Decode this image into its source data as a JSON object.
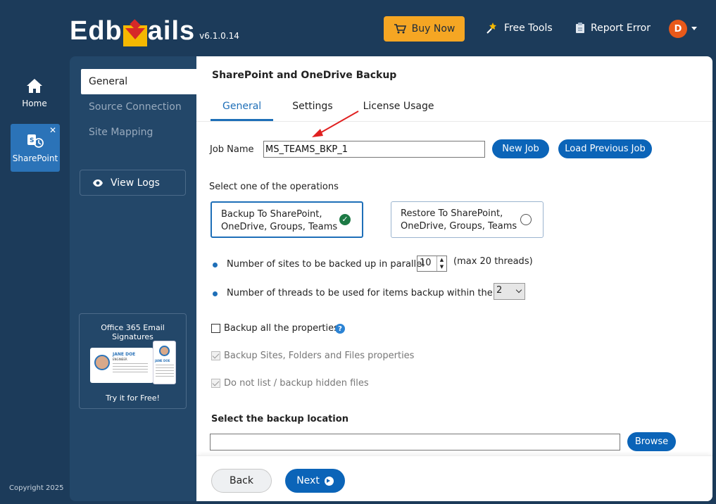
{
  "header": {
    "logo_left": "Edb",
    "logo_right": "ails",
    "version": "v6.1.0.14",
    "buy_now": "Buy Now",
    "free_tools": "Free Tools",
    "report_error": "Report Error",
    "avatar_initial": "D"
  },
  "rail": {
    "home_label": "Home",
    "sharepoint_label": "SharePoint",
    "close_glyph": "✕",
    "copyright": "Copyright 2025"
  },
  "sidenav": {
    "items": [
      {
        "label": "General"
      },
      {
        "label": "Source Connection"
      },
      {
        "label": "Site Mapping"
      }
    ],
    "view_logs": "View Logs",
    "promo_title": "Office 365 Email Signatures",
    "promo_name": "JANE DOE",
    "promo_role": "ENGINEER",
    "promo_cta": "Try it for Free!"
  },
  "main": {
    "title": "SharePoint and OneDrive Backup",
    "tabs": [
      {
        "label": "General"
      },
      {
        "label": "Settings"
      },
      {
        "label": "License Usage"
      }
    ],
    "job_name_label": "Job Name",
    "job_name_value": "MS_TEAMS_BKP_1",
    "new_job": "New Job",
    "load_previous_job": "Load Previous Job",
    "operations_label": "Select one of the operations",
    "op_backup_line1": "Backup To SharePoint,",
    "op_backup_line2": "OneDrive, Groups, Teams",
    "op_restore_line1": "Restore To SharePoint,",
    "op_restore_line2": "OneDrive, Groups, Teams",
    "parallel_sites_label": "Number of sites to be backed up in parallel",
    "parallel_sites_value": "10",
    "parallel_sites_note": "(max 20 threads)",
    "threads_label": "Number of threads to be used for items backup within the sites",
    "threads_value": "2",
    "backup_all_props": "Backup all the properties",
    "backup_sites_props": "Backup Sites, Folders and Files properties",
    "no_hidden": "Do not list / backup hidden files",
    "location_label": "Select the backup location",
    "location_value": "",
    "browse": "Browse",
    "back": "Back",
    "next": "Next"
  },
  "colors": {
    "background": "#1c3b5a",
    "sidenav": "#234769",
    "accent": "#0b64b8",
    "buy_now": "#f5a623",
    "selected_check": "#1d7a45"
  }
}
